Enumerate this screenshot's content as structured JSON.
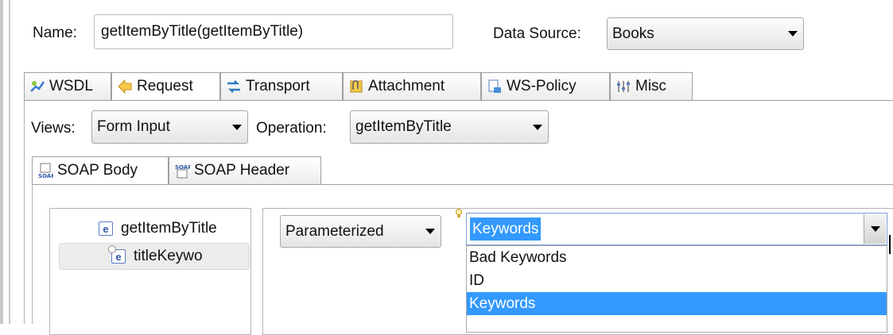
{
  "header": {
    "name_label": "Name:",
    "name_value": "getItemByTitle(getItemByTitle)",
    "data_source_label": "Data Source:",
    "data_source_value": "Books"
  },
  "main_tabs": [
    {
      "label": "WSDL",
      "icon": "wsdl-icon"
    },
    {
      "label": "Request",
      "icon": "request-arrow-icon",
      "active": true
    },
    {
      "label": "Transport",
      "icon": "transport-icon"
    },
    {
      "label": "Attachment",
      "icon": "attachment-icon"
    },
    {
      "label": "WS-Policy",
      "icon": "ws-policy-icon"
    },
    {
      "label": "Misc",
      "icon": "misc-icon"
    }
  ],
  "request": {
    "views_label": "Views:",
    "views_value": "Form Input",
    "operation_label": "Operation:",
    "operation_value": "getItemByTitle"
  },
  "sub_tabs": [
    {
      "label": "SOAP Body",
      "icon": "soap-body-icon",
      "active": true
    },
    {
      "label": "SOAP Header",
      "icon": "soap-header-icon"
    }
  ],
  "tree": [
    {
      "label": "getItemByTitle",
      "icon": "element-icon"
    },
    {
      "label": "titleKeywo",
      "icon": "element-attribute-icon",
      "selected": true
    }
  ],
  "param_mode": "Parameterized",
  "column_combo": {
    "value": "Keywords",
    "options": [
      "Bad Keywords",
      "ID",
      "Keywords"
    ],
    "selected_option": "Keywords"
  },
  "colors": {
    "selection": "#3399ff",
    "tab_border": "#a0a0a0"
  }
}
